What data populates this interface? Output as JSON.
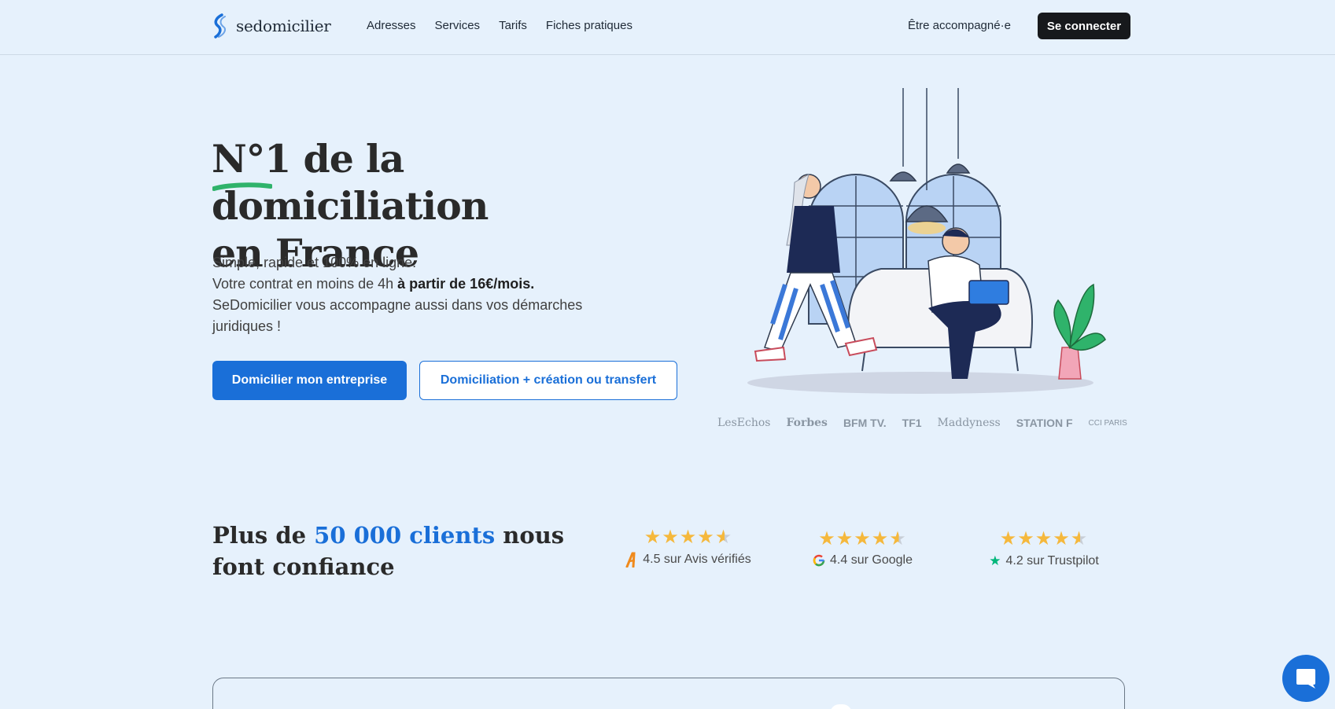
{
  "nav": {
    "logo_text": "sedomicilier",
    "items": [
      {
        "label": "Adresses"
      },
      {
        "label": "Services"
      },
      {
        "label": "Tarifs"
      },
      {
        "label": "Fiches pratiques"
      }
    ],
    "accompany_label": "Être accompagné·e",
    "connect_label": "Se connecter"
  },
  "hero": {
    "title_line1": "N°1 de la domiciliation",
    "title_line2": "en France",
    "text_line1": "Simple, rapide et 100% en ligne.",
    "text_line2_a": "Votre contrat en moins de 4h ",
    "text_line2_b": "à partir de 16€/mois.",
    "text_line3": "SeDomicilier vous accompagne aussi dans vos démarches juridiques !",
    "btn_primary": "Domicilier mon entreprise",
    "btn_secondary": "Domiciliation + création ou transfert"
  },
  "press": [
    "LesEchos",
    "Forbes",
    "BFM TV.",
    "TF1",
    "Maddyness",
    "STATION F",
    "CCI PARIS"
  ],
  "trust": {
    "title_a": "Plus de ",
    "title_highlight": "50 000 clients",
    "title_b": " nous font confiance",
    "ratings": [
      {
        "stars": "★★★★",
        "label": "4.5 sur Avis vérifiés",
        "icon": "avis-verifies-icon"
      },
      {
        "stars": "★★★★",
        "label": "4.4 sur Google",
        "icon": "google-icon"
      },
      {
        "stars": "★★★★",
        "label": "4.2 sur Trustpilot",
        "icon": "trustpilot-icon"
      }
    ]
  },
  "colors": {
    "background": "#e6f1fc",
    "accent": "#1a6fd8",
    "dark_button": "#17191c",
    "star": "#f5b83c"
  }
}
